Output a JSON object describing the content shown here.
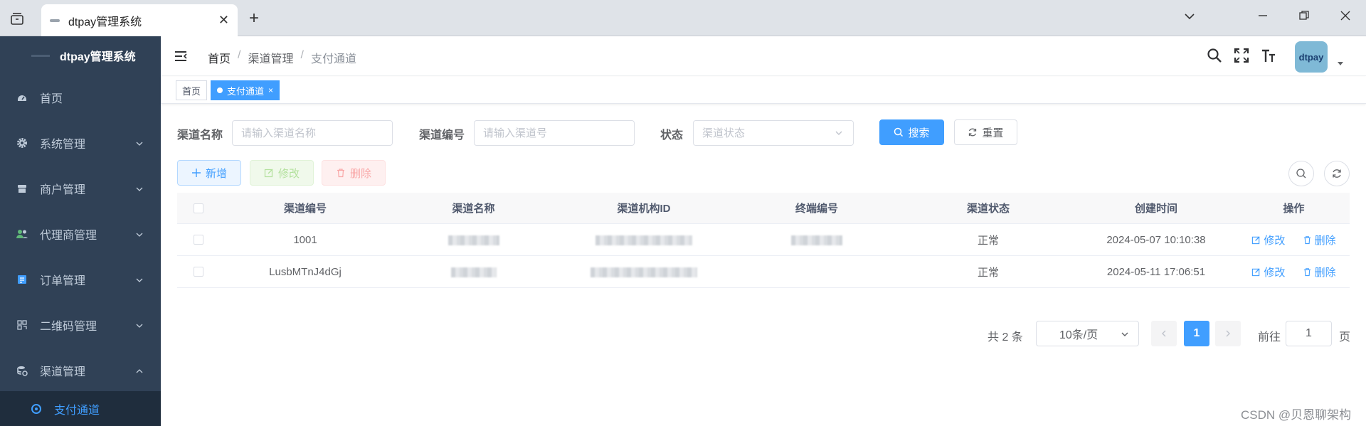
{
  "browser": {
    "tab_title": "dtpay管理系统",
    "close_glyph": "✕",
    "new_tab_glyph": "+"
  },
  "sidebar": {
    "title": "dtpay管理系统",
    "items": [
      {
        "label": "首页",
        "icon": "dashboard-icon"
      },
      {
        "label": "系统管理",
        "icon": "gear-icon"
      },
      {
        "label": "商户管理",
        "icon": "shop-icon"
      },
      {
        "label": "代理商管理",
        "icon": "users-icon"
      },
      {
        "label": "订单管理",
        "icon": "order-icon"
      },
      {
        "label": "二维码管理",
        "icon": "qrcode-icon"
      },
      {
        "label": "渠道管理",
        "icon": "channel-icon"
      }
    ],
    "active_sub": "支付通道"
  },
  "navbar": {
    "breadcrumb": [
      "首页",
      "渠道管理",
      "支付通道"
    ],
    "separator": "/",
    "avatar_text": "dtpay"
  },
  "tags": {
    "home": "首页",
    "active": "支付通道",
    "close_glyph": "×"
  },
  "search": {
    "name_label": "渠道名称",
    "name_placeholder": "请输入渠道名称",
    "code_label": "渠道编号",
    "code_placeholder": "请输入渠道号",
    "status_label": "状态",
    "status_placeholder": "渠道状态",
    "search_button": "搜索",
    "reset_button": "重置"
  },
  "toolbar": {
    "add": "新增",
    "edit": "修改",
    "delete": "删除"
  },
  "table": {
    "columns": [
      "渠道编号",
      "渠道名称",
      "渠道机构ID",
      "终端编号",
      "渠道状态",
      "创建时间",
      "操作"
    ],
    "rows": [
      {
        "code": "1001",
        "status": "正常",
        "created": "2024-05-07 10:10:38"
      },
      {
        "code": "LusbMTnJ4dGj",
        "status": "正常",
        "created": "2024-05-11 17:06:51"
      }
    ],
    "op_edit": "修改",
    "op_delete": "删除"
  },
  "pagination": {
    "total": "共 2 条",
    "page_size": "10条/页",
    "current_page": "1",
    "goto_prefix": "前往",
    "goto_value": "1",
    "goto_suffix": "页"
  },
  "watermark": "CSDN @贝恩聊架构",
  "colors": {
    "primary": "#409eff",
    "sidebar_bg": "#304156",
    "sidebar_sub_bg": "#1f2d3d"
  }
}
